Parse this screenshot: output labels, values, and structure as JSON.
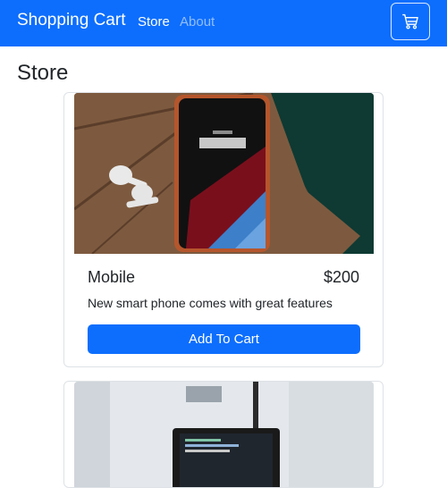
{
  "navbar": {
    "brand": "Shopping Cart",
    "links": [
      {
        "label": "Store",
        "active": true
      },
      {
        "label": "About",
        "active": false
      }
    ],
    "cart_icon": "cart-icon"
  },
  "page": {
    "title": "Store"
  },
  "products": [
    {
      "name": "Mobile",
      "price": "$200",
      "description": "New smart phone comes with great features",
      "button_label": "Add To Cart",
      "image": "phone-with-earbuds-photo"
    },
    {
      "image": "laptop-desk-photo"
    }
  ],
  "colors": {
    "primary": "#0d6efd",
    "text": "#212529",
    "border": "#dee2e6"
  }
}
